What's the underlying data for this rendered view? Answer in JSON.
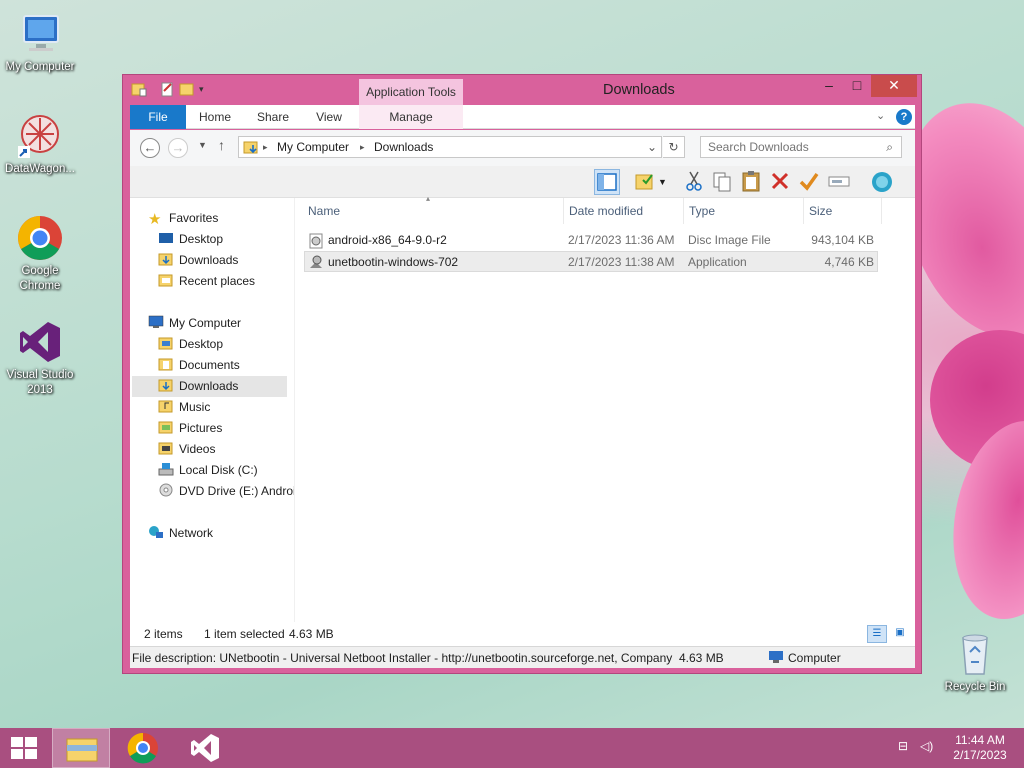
{
  "desktop": {
    "icons": [
      {
        "label": "My Computer"
      },
      {
        "label": "DataWagon..."
      },
      {
        "label": "Google Chrome"
      },
      {
        "label": "Visual Studio 2013"
      },
      {
        "label": "Recycle Bin"
      }
    ]
  },
  "window": {
    "title": "Downloads",
    "contextual_tab_group": "Application Tools",
    "ribbon_tabs": [
      "File",
      "Home",
      "Share",
      "View",
      "Manage"
    ],
    "controls": {
      "minimize": "–",
      "maximize": "□",
      "close": "✕"
    },
    "address": {
      "crumbs": [
        "My Computer",
        "Downloads"
      ]
    },
    "search": {
      "placeholder": "Search Downloads"
    },
    "nav_pane": {
      "favorites_header": "Favorites",
      "favorites": [
        "Desktop",
        "Downloads",
        "Recent places"
      ],
      "computer_header": "My Computer",
      "computer_items": [
        "Desktop",
        "Documents",
        "Downloads",
        "Music",
        "Pictures",
        "Videos",
        "Local Disk (C:)",
        "DVD Drive (E:) Android"
      ],
      "network": "Network"
    },
    "columns": [
      "Name",
      "Date modified",
      "Type",
      "Size"
    ],
    "files": [
      {
        "name": "android-x86_64-9.0-r2",
        "date": "2/17/2023 11:36 AM",
        "type": "Disc Image File",
        "size": "943,104 KB"
      },
      {
        "name": "unetbootin-windows-702",
        "date": "2/17/2023 11:38 AM",
        "type": "Application",
        "size": "4,746 KB"
      }
    ],
    "status": {
      "count": "2 items",
      "selected": "1 item selected",
      "selected_size": "4.63 MB"
    },
    "details": {
      "description": "File description: UNetbootin - Universal Netboot Installer - http://unetbootin.sourceforge.net, Company",
      "size": "4.63 MB",
      "location": "Computer"
    }
  },
  "taskbar": {
    "time": "11:44 AM",
    "date": "2/17/2023"
  },
  "colors": {
    "window_frame": "#d9619c",
    "file_tab": "#1979ca",
    "taskbar": "#a94f80",
    "close_button": "#c94c4c"
  }
}
